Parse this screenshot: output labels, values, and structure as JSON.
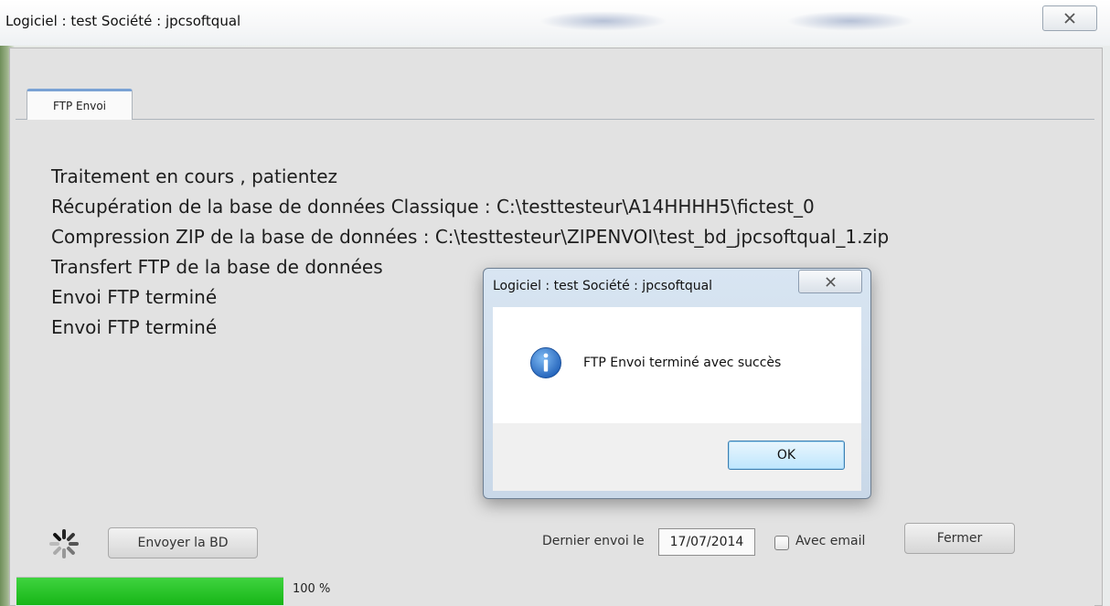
{
  "window": {
    "title": "Logiciel : test Société : jpcsoftqual",
    "close_icon": "close-icon"
  },
  "tabs": [
    {
      "label": "FTP Envoi",
      "active": true
    }
  ],
  "log": {
    "lines": [
      "Traitement en cours , patientez",
      "Récupération de la base  de données  Classique :  C:\\testtesteur\\A14HHHH5\\fictest_0",
      "Compression ZIP de la base  de données  : C:\\testtesteur\\ZIPENVOI\\test_bd_jpcsoftqual_1.zip",
      "Transfert FTP de la base  de données",
      "Envoi FTP terminé",
      "Envoi FTP terminé"
    ]
  },
  "footer": {
    "spinner_icon": "spinner-icon",
    "send_button_label": "Envoyer la BD",
    "last_send_label": "Dernier envoi le",
    "last_send_date": "17/07/2014",
    "email_checkbox_label": "Avec email",
    "email_checked": false,
    "close_button_label": "Fermer",
    "progress_percent": 100,
    "progress_text": "100 %"
  },
  "dialog": {
    "title": "Logiciel : test Société : jpcsoftqual",
    "icon": "info-icon",
    "message": "FTP Envoi terminé avec succès",
    "ok_label": "OK"
  },
  "colors": {
    "progress_fill": "#22c322",
    "tab_accent": "#7aa2d4",
    "info_icon": "#1f6fd0"
  }
}
